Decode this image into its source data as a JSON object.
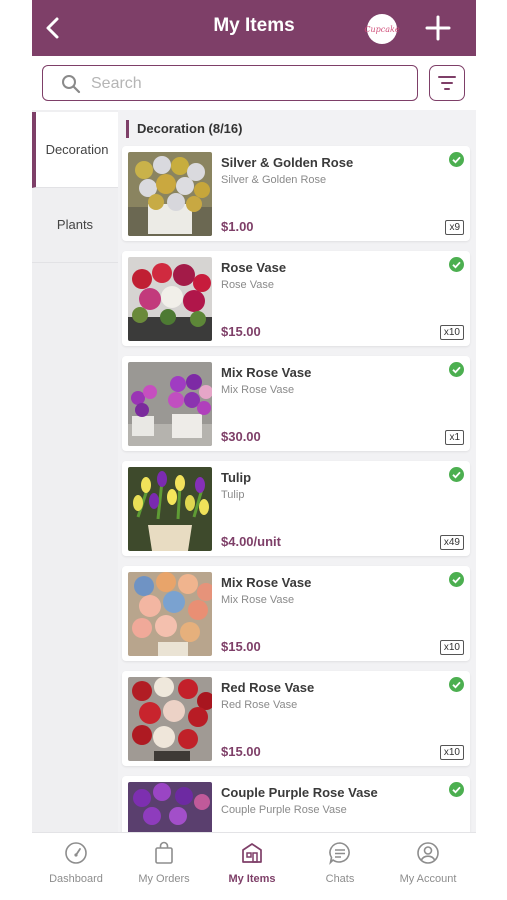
{
  "header": {
    "title": "My Items",
    "logo_text": "Cupcake",
    "back_icon": "chevron-left-icon",
    "add_icon": "plus-icon"
  },
  "search": {
    "placeholder": "Search",
    "value": ""
  },
  "colors": {
    "brand": "#7e3f68",
    "check": "#4caf50"
  },
  "categories": [
    {
      "label": "Decoration",
      "active": true
    },
    {
      "label": "Plants",
      "active": false
    }
  ],
  "section": {
    "title": "Decoration (8/16)"
  },
  "items": [
    {
      "name": "Silver & Golden Rose",
      "subtitle": "Silver & Golden Rose",
      "price": "$1.00",
      "qty": "x9",
      "active": true
    },
    {
      "name": "Rose Vase",
      "subtitle": "Rose Vase",
      "price": "$15.00",
      "qty": "x10",
      "active": true
    },
    {
      "name": "Mix Rose Vase",
      "subtitle": "Mix Rose Vase",
      "price": "$30.00",
      "qty": "x1",
      "active": true
    },
    {
      "name": "Tulip",
      "subtitle": "Tulip",
      "price": "$4.00/unit",
      "qty": "x49",
      "active": true
    },
    {
      "name": "Mix Rose Vase",
      "subtitle": "Mix Rose Vase",
      "price": "$15.00",
      "qty": "x10",
      "active": true
    },
    {
      "name": "Red Rose Vase",
      "subtitle": "Red Rose Vase",
      "price": "$15.00",
      "qty": "x10",
      "active": true
    },
    {
      "name": "Couple Purple Rose Vase",
      "subtitle": "Couple Purple Rose Vase",
      "price": "",
      "qty": "",
      "active": true
    }
  ],
  "nav": [
    {
      "label": "Dashboard",
      "icon": "gauge-icon",
      "active": false
    },
    {
      "label": "My Orders",
      "icon": "bag-icon",
      "active": false
    },
    {
      "label": "My Items",
      "icon": "store-icon",
      "active": true
    },
    {
      "label": "Chats",
      "icon": "chat-icon",
      "active": false
    },
    {
      "label": "My Account",
      "icon": "account-icon",
      "active": false
    }
  ]
}
